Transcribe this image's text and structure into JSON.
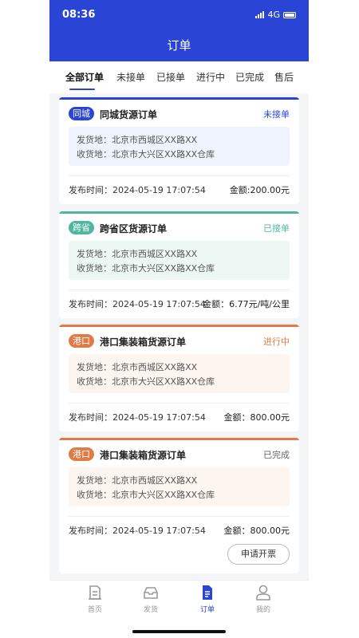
{
  "status_bar": {
    "time": "08:36",
    "network": "4G"
  },
  "header": {
    "title": "订单"
  },
  "tabs": [
    {
      "label": "全部订单",
      "active": true
    },
    {
      "label": "未接单",
      "active": false
    },
    {
      "label": "已接单",
      "active": false
    },
    {
      "label": "进行中",
      "active": false
    },
    {
      "label": "已完成",
      "active": false
    },
    {
      "label": "售后",
      "active": false
    }
  ],
  "orders": [
    {
      "badge": "同城",
      "title": "同城货源订单",
      "status": "未接单",
      "from": "发货地：北京市西城区XX路XX",
      "to": "收货地：北京市大兴区XX路XX仓库",
      "publish_time": "发布时间：2024-05-19  17:07:54",
      "amount": "金额:200.00元",
      "color": "#2a45d6",
      "box_color": "#eef3fd"
    },
    {
      "badge": "跨省",
      "title": "跨省区货源订单",
      "status": "已接单",
      "from": "发货地：北京市西城区XX路XX",
      "to": "收货地：北京市大兴区XX路XX仓库",
      "publish_time": "发布时间：2024-05-19  17:07:54",
      "amount": "金额：6.77元/吨/公里",
      "color": "#4fb6a0",
      "box_color": "#edf8f5"
    },
    {
      "badge": "港口",
      "title": "港口集装箱货源订单",
      "status": "进行中",
      "from": "发货地：北京市西城区XX路XX",
      "to": "收货地：北京市大兴区XX路XX仓库",
      "publish_time": "发布时间：2024-05-19  17:07:54",
      "amount": "金额：800.00元",
      "color": "#e07b48",
      "box_color": "#fdf5ef"
    },
    {
      "badge": "港口",
      "title": "港口集装箱货源订单",
      "status": "已完成",
      "from": "发货地：北京市西城区XX路XX",
      "to": "收货地：北京市大兴区XX路XX仓库",
      "publish_time": "发布时间：2024-05-19  17:07:54",
      "amount": "金额：800.00元",
      "color": "#e07b48",
      "box_color": "#fdf5ef",
      "action_button": "申请开票"
    }
  ],
  "bottom_nav": [
    {
      "label": "首页",
      "icon": "home-icon",
      "active": false
    },
    {
      "label": "发货",
      "icon": "shipping-tray-icon",
      "active": false
    },
    {
      "label": "订单",
      "icon": "order-document-icon",
      "active": true
    },
    {
      "label": "我的",
      "icon": "user-icon",
      "active": false
    }
  ],
  "colors": {
    "primary": "#2a45d6",
    "accent_teal": "#4fb6a0",
    "accent_orange": "#e07b48",
    "status_done": "#666666"
  }
}
